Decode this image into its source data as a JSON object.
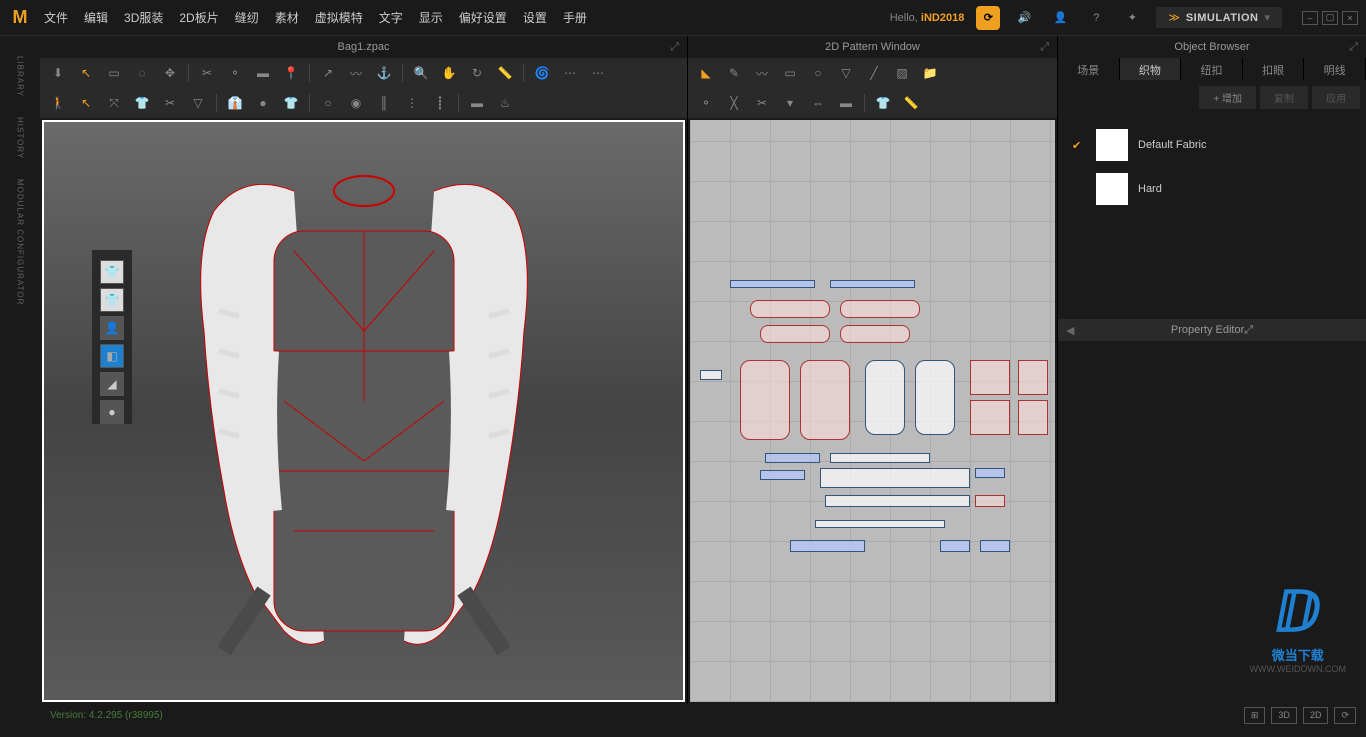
{
  "menu": {
    "items": [
      "文件",
      "编辑",
      "3D服装",
      "2D板片",
      "缝纫",
      "素材",
      "虚拟模特",
      "文字",
      "显示",
      "偏好设置",
      "设置",
      "手册"
    ],
    "hello": "Hello,",
    "user": "iND2018",
    "simulation": "SIMULATION"
  },
  "panels": {
    "p3d_title": "Bag1.zpac",
    "p2d_title": "2D Pattern Window",
    "browser_title": "Object Browser",
    "property_title": "Property Editor"
  },
  "left_rail": [
    "LIBRARY",
    "HISTORY",
    "MODULAR CONFIGURATOR"
  ],
  "browser": {
    "tabs": [
      "场景",
      "织物",
      "纽扣",
      "扣眼",
      "明线"
    ],
    "active_tab": 1,
    "actions": {
      "add": "+ 增加",
      "copy": "复制",
      "apply": "应用"
    },
    "fabrics": [
      {
        "name": "Default Fabric",
        "checked": true
      },
      {
        "name": "Hard",
        "checked": false
      }
    ]
  },
  "status": {
    "version": "Version: 4.2.295 (r38995)",
    "btns": [
      "⊞",
      "3D",
      "2D",
      "⟳"
    ]
  },
  "watermark": {
    "text": "微当下载",
    "url": "WWW.WEIDOWN.COM"
  }
}
